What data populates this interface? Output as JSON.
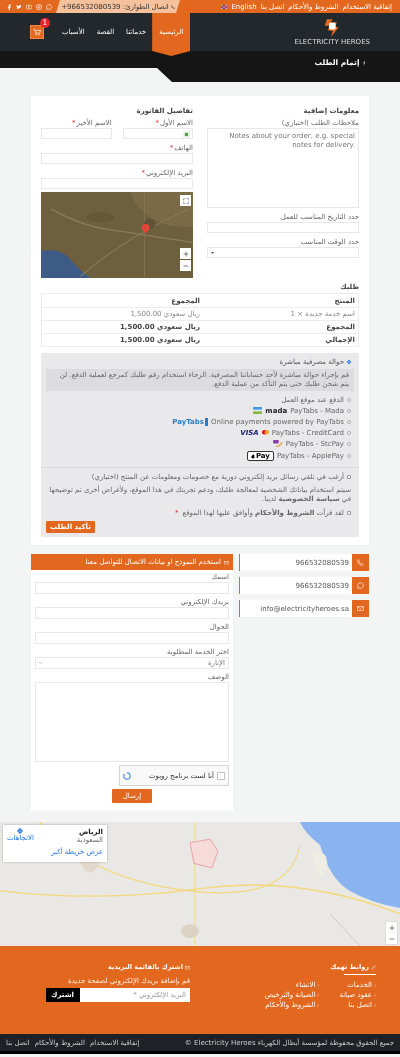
{
  "required_mark": "*",
  "top_bar": {
    "links": [
      "إتفاقية الاستخدام",
      "الشروط والأحكام",
      "اتصل بنا"
    ],
    "language": "English",
    "emergency": "اتصال الطوارئ: 966532080539+"
  },
  "nav": {
    "logo_text": "ELECTRICITY HEROES",
    "items": [
      {
        "label": "الرئيسية",
        "selected": true
      },
      {
        "label": "خدماتنا",
        "selected": false
      },
      {
        "label": "القصة",
        "selected": false
      },
      {
        "label": "الأسباب",
        "selected": false
      }
    ],
    "cart_count": "1"
  },
  "page_title": "إتمام الطلب",
  "additional_info": {
    "title": "معلومات إضافية",
    "notes_label": "ملاحظات الطلب (اختياري)",
    "notes_placeholder": "Notes about your order, e.g. special notes for delivery.",
    "date_label": "حدد التاريخ المناسب للعمل",
    "time_label": "حدد الوقت المناسب"
  },
  "billing": {
    "title": "تفاصيل الفاتورة",
    "name_fields": [
      {
        "label": "الاسم الأول",
        "required": true
      },
      {
        "label": "الاسم الأخير",
        "required": true
      }
    ],
    "fields": [
      {
        "label": "الهاتف",
        "required": true
      },
      {
        "label": "البريد الإلكتروني",
        "required": true
      }
    ]
  },
  "order": {
    "title": "طلبك",
    "columns": [
      "المنتج",
      "المجموع"
    ],
    "rows": [
      {
        "label": "اسم خدمة جديدة × 1",
        "value": "ريال سعودي 1,500.00",
        "kind": "item"
      },
      {
        "label": "المجموع",
        "value": "ريال سعودي 1,500.00",
        "kind": "total"
      },
      {
        "label": "الإجمالي",
        "value": "ريال سعودي 1,500.00",
        "kind": "total"
      }
    ]
  },
  "payment": {
    "methods": [
      {
        "label": "حوالة مصرفية مباشرة",
        "selected": true,
        "kind": "none",
        "description": "قم بإجراء حوالة مباشرة لأحد حساباتنا المصرفية. الرجاء استخدام رقم طلبك كمرجع لعملية الدفع. لن يتم شحن طلبك حتى يتم التأكد من عملية الدفع."
      },
      {
        "label": "الدفع عند موقع العمل",
        "selected": false,
        "kind": "none"
      },
      {
        "label": "PayTabs - Mada",
        "selected": false,
        "kind": "mada",
        "logo_text": "mada"
      },
      {
        "label": "Online payments powered by PayTabs",
        "selected": false,
        "kind": "paytabs",
        "logo_text": "PayTabs"
      },
      {
        "label": "PayTabs - CreditCard",
        "selected": false,
        "kind": "cards",
        "logo_text": "VISA"
      },
      {
        "label": "PayTabs - StcPay",
        "selected": false,
        "kind": "stcpay"
      },
      {
        "label": "PayTabs - ApplePay",
        "selected": false,
        "kind": "applepay",
        "logo_text": "Pay"
      }
    ],
    "newsletter": {
      "label": "أرغب في تلقي رسائل بريد إلكتروني دورية مع خصومات ومعلومات عن المنتج (اختياري)",
      "checked": false
    },
    "privacy": "سيتم استخدام بياناتك الشخصية لمعالجة طلبك، ودعم تجربتك في هذا الموقع، ولأغراض أخرى تم توضيحها في **سياسة الخصوصية** لدينا.",
    "terms": {
      "label": "لقد قرأت **الشروط والأحكام** وأوافق عليها لهذا الموقع",
      "checked": false,
      "required": true
    },
    "button": "تأكيد الطلب"
  },
  "contact": {
    "title": "استخدم النموذج او بيانات الاتصال للتواصل معنا",
    "name_label": "اسمك",
    "email_label": "بريدك الإلكتروني",
    "mobile_label": "الجوال",
    "service_label": "اختر الخدمة المطلوبة",
    "service_value": "الإنارة",
    "description_label": "الوصف",
    "captcha": {
      "label": "أنا لست برنامج روبوت",
      "checked": false
    },
    "button": "إرسال",
    "cards": [
      {
        "kind": "phone",
        "text": "966532080539"
      },
      {
        "kind": "whatsapp",
        "text": "966532080539"
      },
      {
        "kind": "email",
        "text": "info@electricityheroes.sa"
      }
    ]
  },
  "location_map": {
    "kind": "picture",
    "place": "الرياض",
    "region": "السعودية",
    "directions": "الاتجاهات",
    "larger_map": "عرض خريطة أكبر"
  },
  "footer": {
    "links_title": "روابط تهمك",
    "links": [
      [
        "الخدمات",
        "عقود صيانة",
        "اتصل بنا"
      ],
      [
        "الانشاء",
        "الصيانة والترخيص",
        "الشروط والأحكام"
      ]
    ],
    "newsletter_title": "اشترك بالقائمة البريدية",
    "newsletter_text": "قم بإضافة بريدك الإلكتروني لصفحة جديدة",
    "email_placeholder": "البريد الإلكتروني *",
    "subscribe": "اشترك"
  },
  "bottom_bar": {
    "copyright": "جميع الحقوق محفوظة لمؤسسة أبطال الكهرباء Electricity Heroes ©",
    "links": [
      "إتفاقية الاستخدام",
      "الشروط والأحكام",
      "اتصل بنا"
    ]
  }
}
